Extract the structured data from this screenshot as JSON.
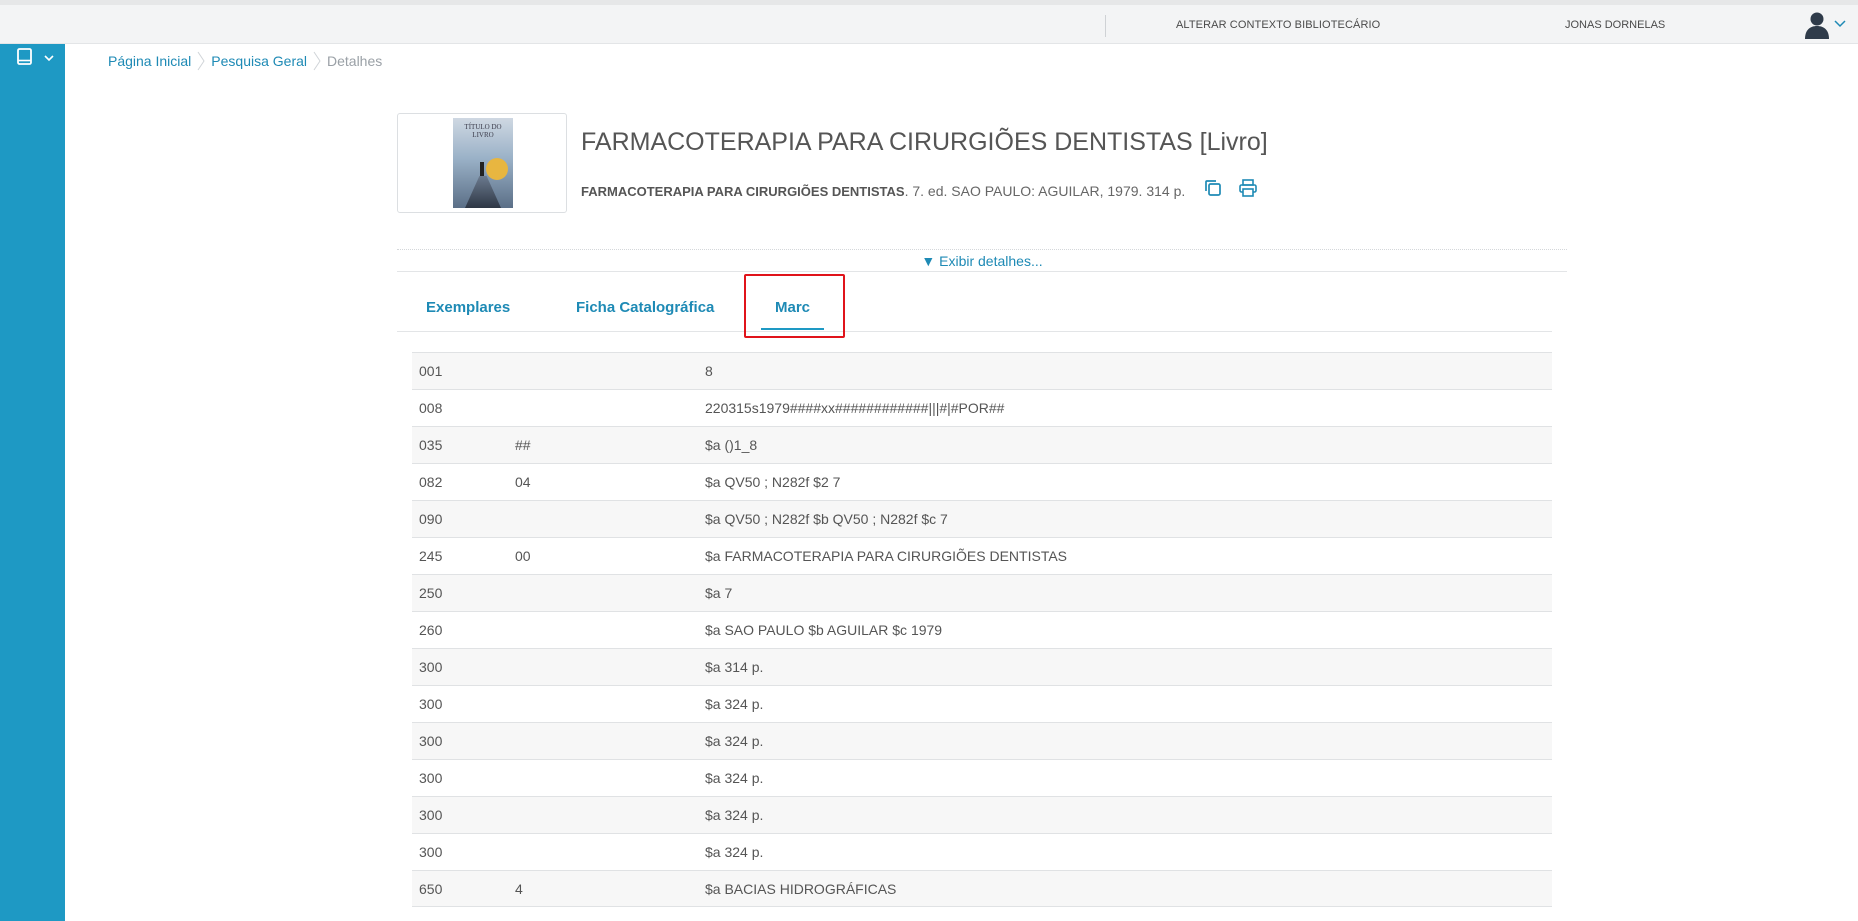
{
  "topbar": {
    "context_label": "ALTERAR CONTEXTO BIBLIOTECÁRIO",
    "user_name": "JONAS DORNELAS"
  },
  "colors": {
    "sidebar": "#1e99c4",
    "accent_link": "#1e8ab5",
    "highlight_box": "#e0141b"
  },
  "breadcrumb": {
    "home": "Página Inicial",
    "search": "Pesquisa Geral",
    "current": "Detalhes"
  },
  "book": {
    "cover_text": "TÍTULO DO LIVRO",
    "title": "FARMACOTERAPIA PARA CIRURGIÕES DENTISTAS [Livro]",
    "reference_bold": "FARMACOTERAPIA PARA CIRURGIÕES DENTISTAS",
    "reference_rest": ". 7. ed. SAO PAULO: AGUILAR, 1979. 314 p.",
    "copy_icon": "copy-icon",
    "print_icon": "print-icon"
  },
  "details_toggle": "▼ Exibir detalhes...",
  "tabs": [
    {
      "label": "Exemplares"
    },
    {
      "label": "Ficha Catalográfica"
    },
    {
      "label": "Marc",
      "active": true
    }
  ],
  "marc_rows": [
    {
      "tag": "001",
      "ind": "",
      "value": "8"
    },
    {
      "tag": "008",
      "ind": "",
      "value": "220315s1979####xx############|||#|#POR##"
    },
    {
      "tag": "035",
      "ind": "##",
      "value": "$a ()1_8"
    },
    {
      "tag": "082",
      "ind": "04",
      "value": "$a QV50 ; N282f $2 7"
    },
    {
      "tag": "090",
      "ind": "",
      "value": "$a QV50 ; N282f $b QV50 ; N282f $c 7"
    },
    {
      "tag": "245",
      "ind": "00",
      "value": "$a FARMACOTERAPIA PARA CIRURGIÕES DENTISTAS"
    },
    {
      "tag": "250",
      "ind": "",
      "value": "$a 7"
    },
    {
      "tag": "260",
      "ind": "",
      "value": "$a SAO PAULO $b AGUILAR $c 1979"
    },
    {
      "tag": "300",
      "ind": "",
      "value": "$a 314 p."
    },
    {
      "tag": "300",
      "ind": "",
      "value": "$a 324 p."
    },
    {
      "tag": "300",
      "ind": "",
      "value": "$a 324 p."
    },
    {
      "tag": "300",
      "ind": "",
      "value": "$a 324 p."
    },
    {
      "tag": "300",
      "ind": "",
      "value": "$a 324 p."
    },
    {
      "tag": "300",
      "ind": "",
      "value": "$a 324 p."
    },
    {
      "tag": "650",
      "ind": "4",
      "value": "$a BACIAS HIDROGRÁFICAS"
    }
  ]
}
